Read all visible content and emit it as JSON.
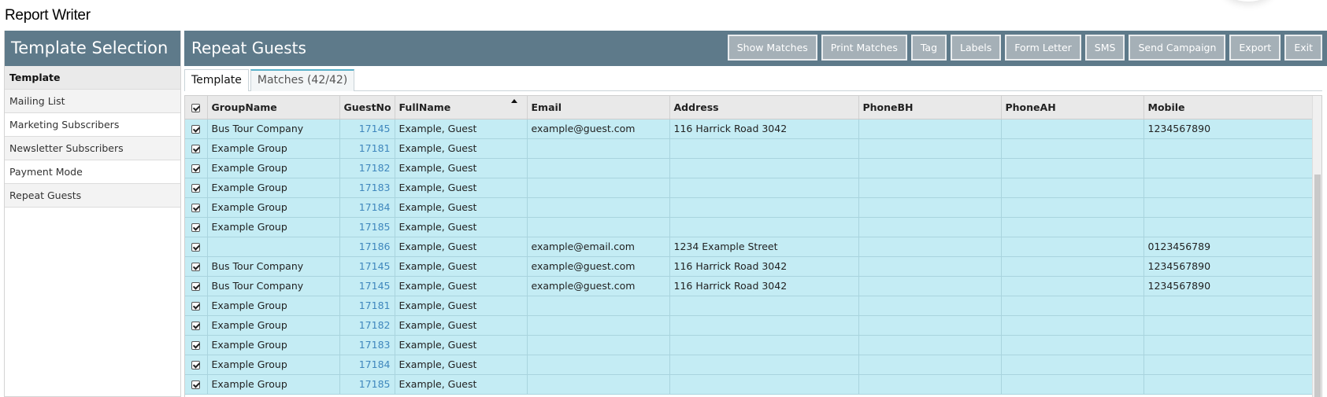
{
  "app": {
    "title": "Report Writer"
  },
  "sidebar": {
    "title": "Template Selection",
    "items": [
      {
        "label": "Template"
      },
      {
        "label": "Mailing List"
      },
      {
        "label": "Marketing Subscribers"
      },
      {
        "label": "Newsletter Subscribers"
      },
      {
        "label": "Payment Mode"
      },
      {
        "label": "Repeat Guests"
      }
    ]
  },
  "main": {
    "title": "Repeat Guests",
    "toolbar": {
      "show_matches": "Show Matches",
      "print_matches": "Print Matches",
      "tag": "Tag",
      "labels": "Labels",
      "form_letter": "Form Letter",
      "sms": "SMS",
      "send_campaign": "Send Campaign",
      "export": "Export",
      "exit": "Exit"
    },
    "tabs": [
      {
        "label": "Template"
      },
      {
        "label": "Matches (42/42)"
      }
    ],
    "grid": {
      "columns": [
        "GroupName",
        "GuestNo",
        "FullName",
        "Email",
        "Address",
        "PhoneBH",
        "PhoneAH",
        "Mobile"
      ],
      "sorted_column": "FullName",
      "rows": [
        [
          "Bus Tour Company",
          "17145",
          "Example, Guest",
          "example@guest.com",
          "116 Harrick Road 3042",
          "",
          "",
          "1234567890"
        ],
        [
          "Example Group",
          "17181",
          "Example, Guest",
          "",
          "",
          "",
          "",
          ""
        ],
        [
          "Example Group",
          "17182",
          "Example, Guest",
          "",
          "",
          "",
          "",
          ""
        ],
        [
          "Example Group",
          "17183",
          "Example, Guest",
          "",
          "",
          "",
          "",
          ""
        ],
        [
          "Example Group",
          "17184",
          "Example, Guest",
          "",
          "",
          "",
          "",
          ""
        ],
        [
          "Example Group",
          "17185",
          "Example, Guest",
          "",
          "",
          "",
          "",
          ""
        ],
        [
          "",
          "17186",
          "Example, Guest",
          "example@email.com",
          "1234 Example Street",
          "",
          "",
          "0123456789"
        ],
        [
          "Bus Tour Company",
          "17145",
          "Example, Guest",
          "example@guest.com",
          "116 Harrick Road 3042",
          "",
          "",
          "1234567890"
        ],
        [
          "Bus Tour Company",
          "17145",
          "Example, Guest",
          "example@guest.com",
          "116 Harrick Road 3042",
          "",
          "",
          "1234567890"
        ],
        [
          "Example Group",
          "17181",
          "Example, Guest",
          "",
          "",
          "",
          "",
          ""
        ],
        [
          "Example Group",
          "17182",
          "Example, Guest",
          "",
          "",
          "",
          "",
          ""
        ],
        [
          "Example Group",
          "17183",
          "Example, Guest",
          "",
          "",
          "",
          "",
          ""
        ],
        [
          "Example Group",
          "17184",
          "Example, Guest",
          "",
          "",
          "",
          "",
          ""
        ],
        [
          "Example Group",
          "17185",
          "Example, Guest",
          "",
          "",
          "",
          "",
          ""
        ]
      ]
    }
  },
  "colors": {
    "header_bg": "#5e7a8a",
    "button_bg": "#a5b0b7",
    "row_bg": "#c4ecf4",
    "link_number": "#3f87bd"
  }
}
